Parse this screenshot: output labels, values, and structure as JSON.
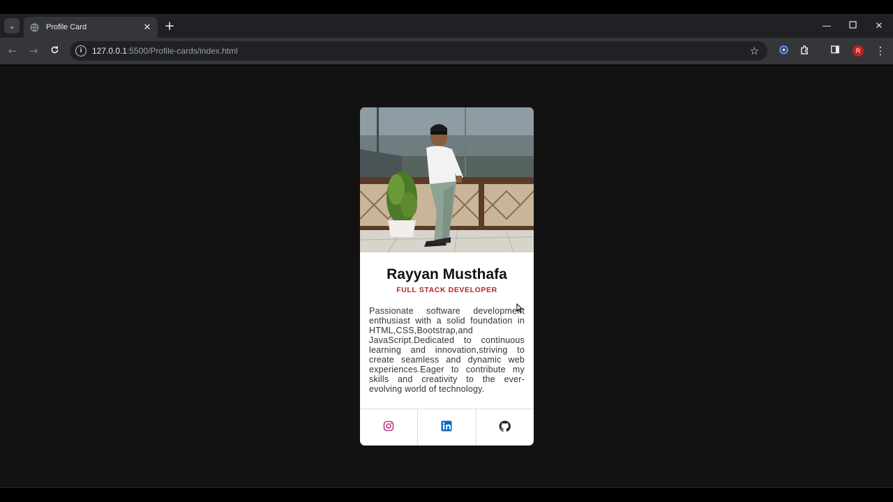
{
  "browser": {
    "tab": {
      "title": "Profile Card"
    },
    "address": {
      "host": "127.0.0.1",
      "path": ":5500/Profile-cards/index.html"
    },
    "profile_initial": "R"
  },
  "card": {
    "name": "Rayyan Musthafa",
    "role": "FULL STACK DEVELOPER",
    "bio": "Passionate software development enthusiast with a solid foundation in HTML,CSS,Bootstrap,and JavaScript.Dedicated to continuous learning and innovation,striving to create seamless and dynamic web experiences.Eager to contribute my skills and creativity to the ever-evolving world of technology.",
    "socials": [
      {
        "icon": "instagram-icon",
        "color": "#c13584"
      },
      {
        "icon": "linkedin-icon",
        "color": "#0a66c2"
      },
      {
        "icon": "github-icon",
        "color": "#222222"
      }
    ]
  },
  "colors": {
    "page_background": "#121212",
    "role_accent": "#b3261e"
  }
}
